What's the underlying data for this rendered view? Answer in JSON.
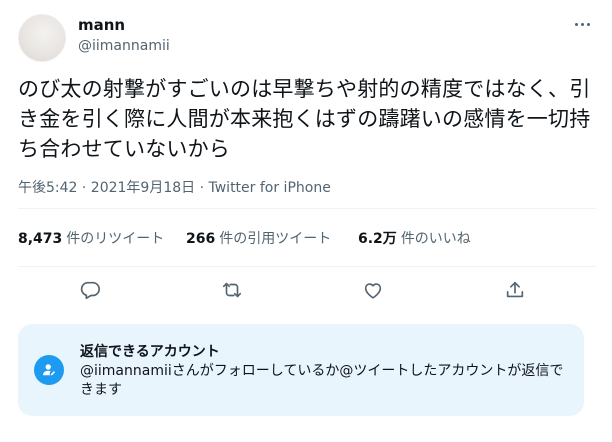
{
  "author": {
    "display_name": "mann",
    "handle": "@iimannamii"
  },
  "tweet": {
    "text": "のび太の射撃がすごいのは早撃ちや射的の精度ではなく、引き金を引く際に人間が本来抱くはずの躊躇いの感情を一切持ち合わせていないから",
    "meta": "午後5:42 · 2021年9月18日 · Twitter for iPhone"
  },
  "stats": {
    "retweets_count": "8,473",
    "retweets_label": "件のリツイート",
    "quotes_count": "266",
    "quotes_label": "件の引用ツイート",
    "likes_count": "6.2万",
    "likes_label": "件のいいね"
  },
  "icons": {
    "more": "more-icon",
    "reply": "reply-icon",
    "retweet": "retweet-icon",
    "like": "like-icon",
    "share": "share-icon",
    "notice": "user-icon"
  },
  "reply_notice": {
    "title": "返信できるアカウント",
    "description": "@iimannamiiさんがフォローしているか@ツイートしたアカウントが返信できます"
  },
  "colors": {
    "accent": "#1d9bf0",
    "notice_background": "#e8f5fd",
    "secondary_text": "#536471"
  }
}
